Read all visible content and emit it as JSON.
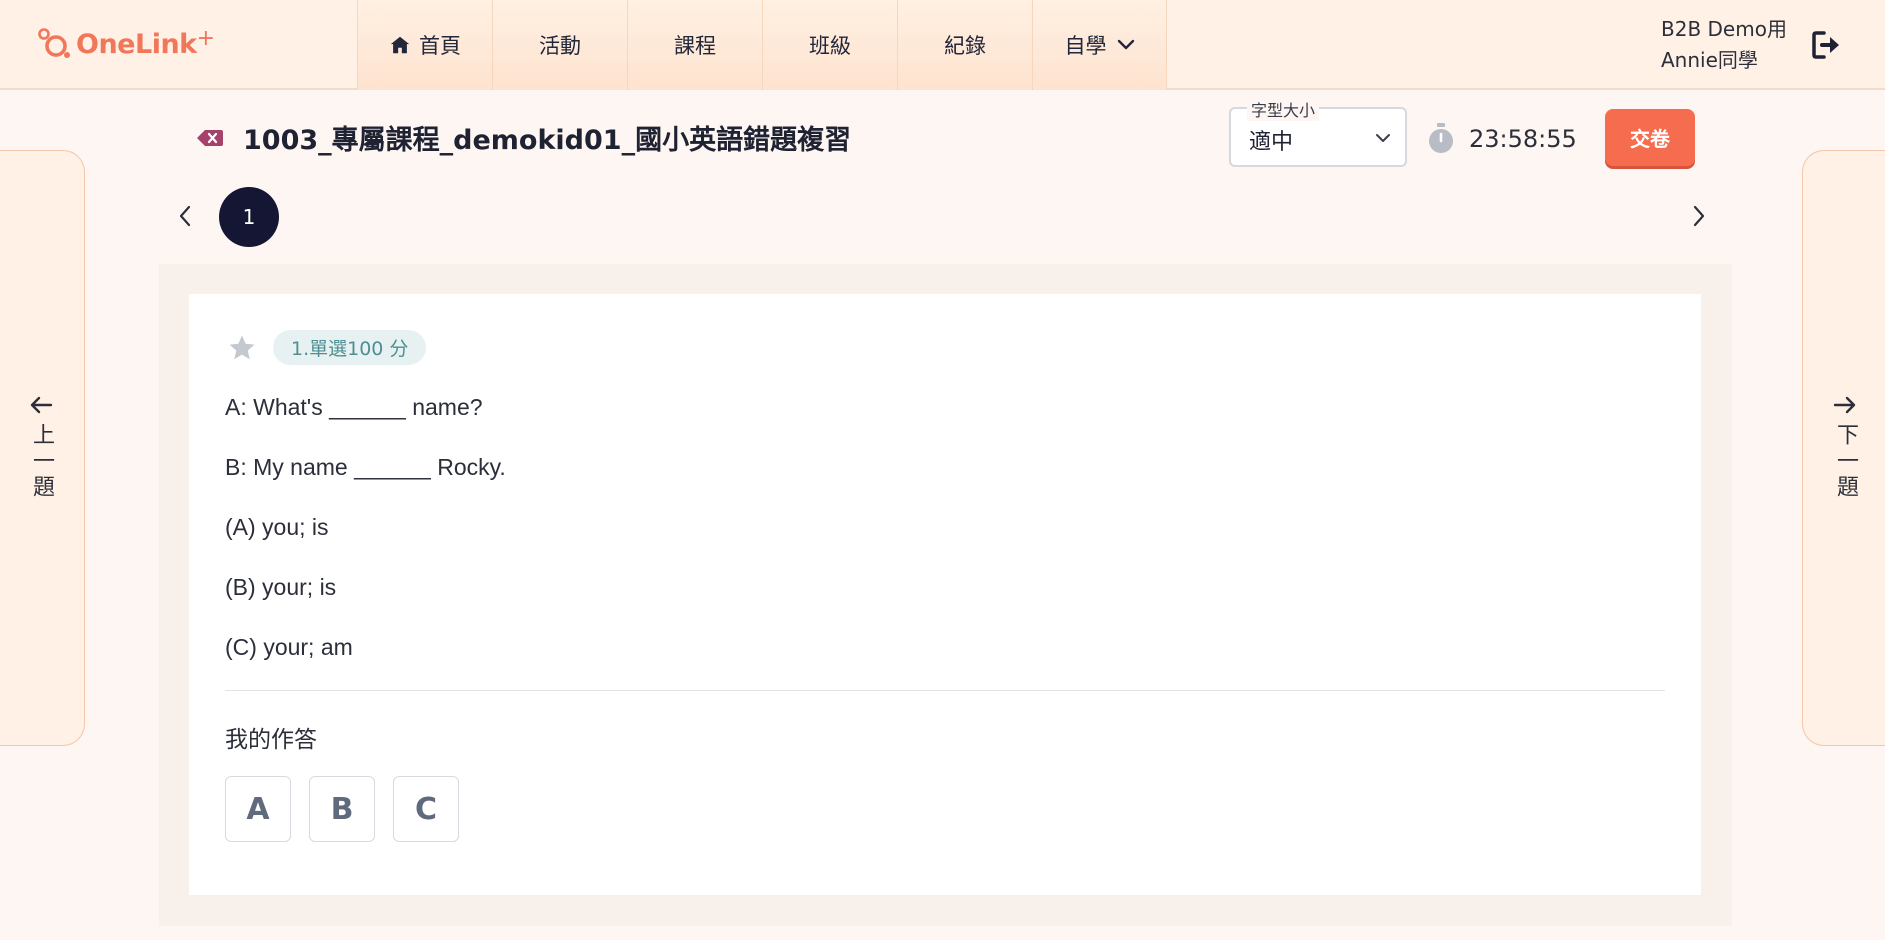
{
  "header": {
    "logo_text": "OneLink",
    "logo_plus": "+",
    "nav": [
      {
        "label": "首頁",
        "icon": "home-icon"
      },
      {
        "label": "活動"
      },
      {
        "label": "課程"
      },
      {
        "label": "班級"
      },
      {
        "label": "紀錄"
      },
      {
        "label": "自學",
        "icon": "chevron-down-icon"
      }
    ],
    "user_line1": "B2B Demo用",
    "user_line2": "Annie同學"
  },
  "side": {
    "prev_label": "上一題",
    "next_label": "下一題"
  },
  "exam": {
    "title": "1003_專屬課程_demokid01_國小英語錯題複習",
    "font_size_label": "字型大小",
    "font_size_value": "適中",
    "timer": "23:58:55",
    "submit_label": "交卷"
  },
  "pager": {
    "current": "1"
  },
  "question": {
    "badge": "1.單選100 分",
    "lines": [
      "A: What's ______ name?",
      "B: My name ______ Rocky.",
      "(A) you; is",
      "(B) your; is",
      "(C) your; am"
    ],
    "my_answer_label": "我的作答",
    "options": [
      "A",
      "B",
      "C"
    ]
  },
  "colors": {
    "brand": "#f0775a",
    "submit": "#f56c4f",
    "pager_active": "#141633",
    "badge_text": "#4e8f93"
  }
}
